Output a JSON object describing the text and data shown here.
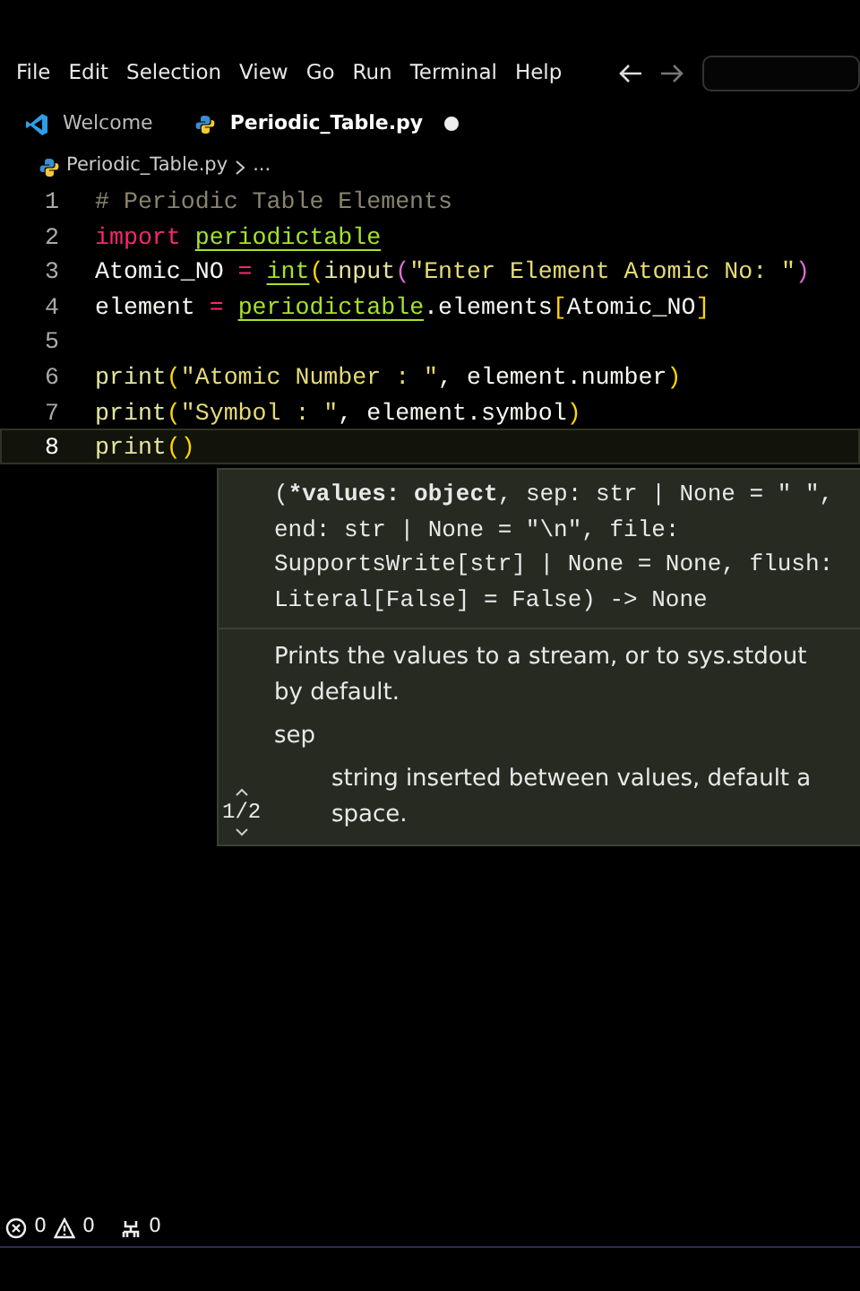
{
  "menu": [
    "File",
    "Edit",
    "Selection",
    "View",
    "Go",
    "Run",
    "Terminal",
    "Help"
  ],
  "tabs": [
    {
      "label": "Welcome",
      "selected": false,
      "modified": false
    },
    {
      "label": "Periodic_Table.py",
      "selected": true,
      "modified": true
    }
  ],
  "breadcrumb": [
    "Periodic_Table.py",
    "..."
  ],
  "editor": {
    "lines": [
      {
        "number": "1",
        "current": false,
        "tokens": [
          {
            "text": "# Periodic Table Elements",
            "kind": "comment"
          }
        ]
      },
      {
        "number": "2",
        "current": false,
        "tokens": [
          {
            "text": "import ",
            "kind": "keyword"
          },
          {
            "text": "periodictable",
            "kind": "module"
          }
        ]
      },
      {
        "number": "3",
        "current": false,
        "tokens": [
          {
            "text": "Atomic_NO ",
            "kind": "name"
          },
          {
            "text": "= ",
            "kind": "op"
          },
          {
            "text": "int",
            "kind": "module"
          },
          {
            "text": "(",
            "kind": "bracket"
          },
          {
            "text": "input",
            "kind": "func"
          },
          {
            "text": "(",
            "kind": "bracket2"
          },
          {
            "text": "\"Enter Element Atomic No: \"",
            "kind": "string"
          },
          {
            "text": ")",
            "kind": "bracket2"
          }
        ]
      },
      {
        "number": "4",
        "current": false,
        "tokens": [
          {
            "text": "element ",
            "kind": "name"
          },
          {
            "text": "= ",
            "kind": "op"
          },
          {
            "text": "periodictable",
            "kind": "module"
          },
          {
            "text": ".elements",
            "kind": "name"
          },
          {
            "text": "[",
            "kind": "bracket"
          },
          {
            "text": "Atomic_NO",
            "kind": "name"
          },
          {
            "text": "]",
            "kind": "bracket"
          }
        ]
      },
      {
        "number": "5",
        "current": false
      },
      {
        "number": "6",
        "current": false,
        "tokens": [
          {
            "text": "print",
            "kind": "func"
          },
          {
            "text": "(",
            "kind": "bracket"
          },
          {
            "text": "\"Atomic Number : \"",
            "kind": "string"
          },
          {
            "text": ", element.number",
            "kind": "name"
          },
          {
            "text": ")",
            "kind": "bracket"
          }
        ]
      },
      {
        "number": "7",
        "current": false,
        "tokens": [
          {
            "text": "print",
            "kind": "func"
          },
          {
            "text": "(",
            "kind": "bracket"
          },
          {
            "text": "\"Symbol : \"",
            "kind": "string"
          },
          {
            "text": ", element.symbol",
            "kind": "name"
          },
          {
            "text": ")",
            "kind": "bracket"
          }
        ]
      },
      {
        "number": "8",
        "current": true,
        "tokens": [
          {
            "text": "print",
            "kind": "func"
          },
          {
            "text": "(",
            "kind": "bracket"
          },
          {
            "text": ")",
            "kind": "bracket"
          }
        ]
      }
    ]
  },
  "signature_help": {
    "signature_lines": [
      [
        {
          "text": "(",
          "bold": false
        },
        {
          "text": "*values: object",
          "bold": true
        },
        {
          "text": ", sep: str | None = \" \",",
          "bold": false
        }
      ],
      [
        {
          "text": "end: str | None = \"\\n\", file:",
          "bold": false
        }
      ],
      [
        {
          "text": "SupportsWrite[str] | None = None, flush:",
          "bold": false
        }
      ],
      [
        {
          "text": "Literal[False] = False) -> None",
          "bold": false
        }
      ]
    ],
    "description": "Prints the values to a stream, or to sys.stdout by default.",
    "parameter": "sep",
    "parameter_description": "string inserted between values, default a space.",
    "pager": "1/2"
  },
  "status_bar": [
    {
      "kind": "errors",
      "count": "0"
    },
    {
      "kind": "warnings",
      "count": "0"
    },
    {
      "kind": "ports",
      "count": "0"
    }
  ]
}
